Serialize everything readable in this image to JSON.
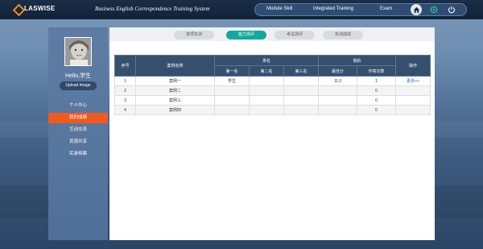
{
  "brand": {
    "logo_text": "LASWISE"
  },
  "header": {
    "app_title": "Business English Correspondence Training System",
    "nav": [
      "Module Skill",
      "Integrated Training",
      "Exam"
    ],
    "icons": [
      "home-icon",
      "gear-icon",
      "power-icon"
    ]
  },
  "sidebar": {
    "greeting": "Hello,学生",
    "upload_label": "Upload Image",
    "menu": [
      "个人中心",
      "我的成绩",
      "互动交流",
      "资源共享",
      "实录档案"
    ],
    "active_index": 1,
    "active_color": "#f05a1e"
  },
  "tabs": {
    "items": [
      "单项实训",
      "能力测评",
      "考试测评",
      "实训成绩"
    ],
    "active_index": 1,
    "active_color": "#13a89e"
  },
  "table": {
    "headers": {
      "index": "序号",
      "case_name": "案例名称",
      "ranking_group": "排名",
      "ranks": [
        "第一名",
        "第二名",
        "第三名"
      ],
      "score_group": "我的",
      "best_score": "最佳分",
      "attempts": "作答次数",
      "action": "操作"
    },
    "rows": [
      {
        "index": "1",
        "case_name": "案例一",
        "rank1": "学生",
        "rank2": "",
        "rank3": "",
        "best_score": "11.0",
        "attempts": "1",
        "action": "更多>>"
      },
      {
        "index": "2",
        "case_name": "案例二",
        "rank1": "",
        "rank2": "",
        "rank3": "",
        "best_score": "",
        "attempts": "0",
        "action": ""
      },
      {
        "index": "3",
        "case_name": "案例三",
        "rank1": "",
        "rank2": "",
        "rank3": "",
        "best_score": "",
        "attempts": "0",
        "action": ""
      },
      {
        "index": "4",
        "case_name": "案例四",
        "rank1": "",
        "rank2": "",
        "rank3": "",
        "best_score": "",
        "attempts": "0",
        "action": ""
      }
    ]
  }
}
